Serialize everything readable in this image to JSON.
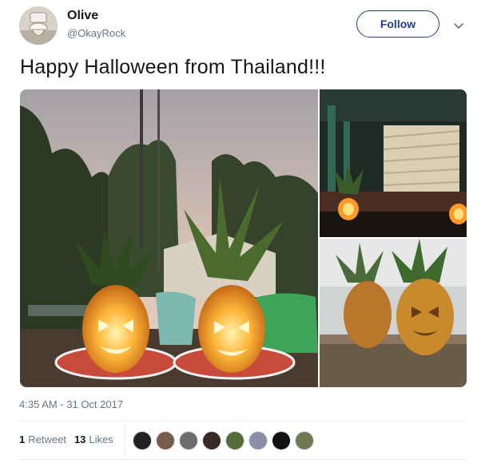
{
  "user": {
    "display_name": "Olive",
    "handle": "@OkayRock",
    "avatar_icon": "toilet-icon"
  },
  "follow_button": {
    "label": "Follow"
  },
  "menu_icon": "chevron-down-icon",
  "tweet": {
    "text": "Happy Halloween from Thailand!!!",
    "timestamp": "4:35 AM - 31 Oct 2017"
  },
  "media": [
    {
      "name": "photo-pineapple-lanterns-dusk"
    },
    {
      "name": "photo-pineapple-lanterns-porch"
    },
    {
      "name": "photo-pineapple-lanterns-table"
    }
  ],
  "stats": {
    "retweets_count": "1",
    "retweets_label": "Retweet",
    "likes_count": "13",
    "likes_label": "Likes"
  },
  "likers": [
    {
      "name": "liker-1",
      "color": "#222222"
    },
    {
      "name": "liker-2",
      "color": "#7a5c4a"
    },
    {
      "name": "liker-3",
      "color": "#6d6d6d"
    },
    {
      "name": "liker-4",
      "color": "#3a2a24"
    },
    {
      "name": "liker-5",
      "color": "#556b3a"
    },
    {
      "name": "liker-6",
      "color": "#8a8fa6"
    },
    {
      "name": "liker-7",
      "color": "#111111"
    },
    {
      "name": "liker-8",
      "color": "#6f7a55"
    }
  ],
  "colors": {
    "brand_blue": "#1d3e8a",
    "secondary_text": "#657786",
    "divider": "#e6ecf0"
  }
}
